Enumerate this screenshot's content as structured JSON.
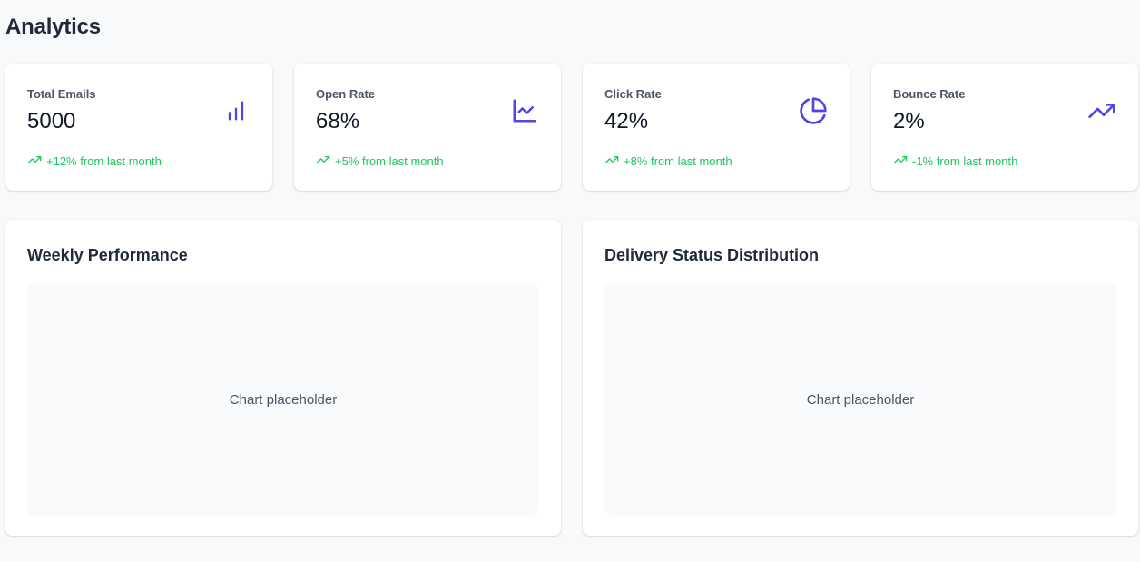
{
  "page": {
    "title": "Analytics"
  },
  "colors": {
    "accent": "#4f46e5",
    "trend_positive": "#22c55e",
    "background": "#f8f9fb"
  },
  "stats": [
    {
      "label": "Total Emails",
      "value": "5000",
      "trend": "+12% from last month",
      "icon": "bar-chart-icon"
    },
    {
      "label": "Open Rate",
      "value": "68%",
      "trend": "+5% from last month",
      "icon": "line-chart-icon"
    },
    {
      "label": "Click Rate",
      "value": "42%",
      "trend": "+8% from last month",
      "icon": "pie-chart-icon"
    },
    {
      "label": "Bounce Rate",
      "value": "2%",
      "trend": "-1% from last month",
      "icon": "trending-up-icon"
    }
  ],
  "charts": [
    {
      "title": "Weekly Performance",
      "placeholder": "Chart placeholder"
    },
    {
      "title": "Delivery Status Distribution",
      "placeholder": "Chart placeholder"
    }
  ]
}
